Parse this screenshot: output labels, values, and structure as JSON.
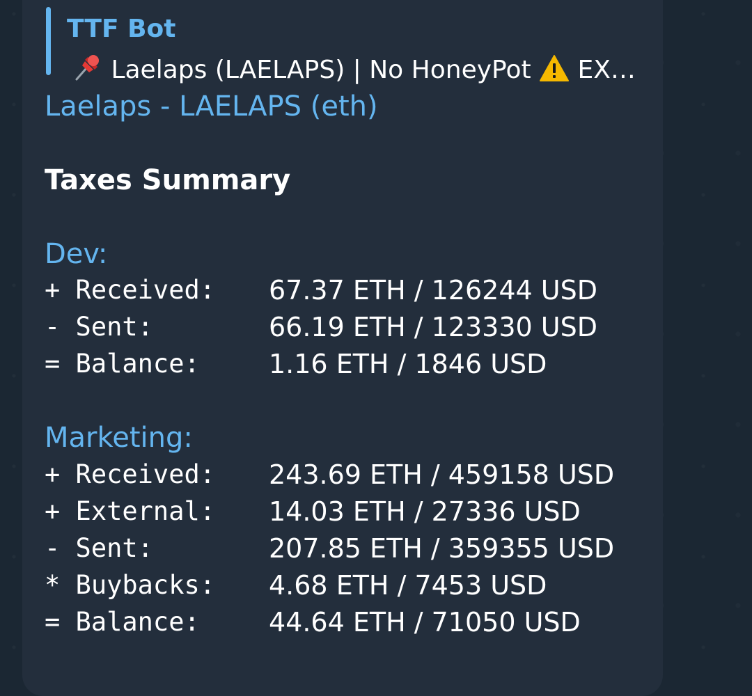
{
  "reply": {
    "author": "TTF Bot",
    "pin_icon": "pushpin-icon",
    "text_before": " Laelaps (LAELAPS) | No HoneyPot ",
    "warning_icon": "warning-icon",
    "text_after": " EX…"
  },
  "message": {
    "link_text": "Laelaps - LAELAPS (eth)",
    "heading": "Taxes Summary",
    "dev": {
      "title": "Dev:",
      "rows": [
        {
          "label": "+ Received:",
          "value": "67.37 ETH / 126244 USD"
        },
        {
          "label": "- Sent:",
          "value": "66.19 ETH / 123330 USD"
        },
        {
          "label": "= Balance:",
          "value": "1.16 ETH / 1846 USD"
        }
      ]
    },
    "marketing": {
      "title": "Marketing:",
      "rows": [
        {
          "label": "+ Received:",
          "value": "243.69 ETH / 459158 USD"
        },
        {
          "label": "+ External:",
          "value": "14.03 ETH / 27336 USD"
        },
        {
          "label": "- Sent:",
          "value": "207.85 ETH / 359355 USD"
        },
        {
          "label": "* Buybacks:",
          "value": "4.68 ETH / 7453 USD"
        },
        {
          "label": "= Balance:",
          "value": "44.64 ETH / 71050 USD"
        }
      ]
    }
  },
  "colors": {
    "background": "#1b2733",
    "bubble": "#232e3c",
    "accent": "#64b5ef",
    "text": "#ffffff",
    "warning": "#f5b800",
    "pin": "#e53935"
  }
}
